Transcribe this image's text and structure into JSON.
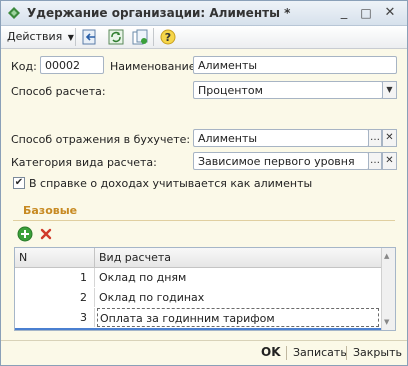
{
  "window": {
    "title": "Удержание организации: Алименты *",
    "controls": {
      "minimize": "_",
      "maximize": "□",
      "close": "✕"
    }
  },
  "toolbar": {
    "actions_label": "Действия",
    "icons": [
      "go-back-icon",
      "refresh-icon",
      "copy-icon",
      "help-icon"
    ]
  },
  "form": {
    "code_label": "Код:",
    "code_value": "00002",
    "name_label": "Наименование:",
    "name_value": "Алименты",
    "calc_method_label": "Способ расчета:",
    "calc_method_value": "Процентом",
    "accounting_label": "Способ отражения в бухучете:",
    "accounting_value": "Алименты",
    "category_label": "Категория вида расчета:",
    "category_value": "Зависимое первого уровня",
    "checkbox_label": "В справке о доходах учитывается как алименты",
    "checkbox_checked": true
  },
  "base_section": {
    "title": "Базовые",
    "table": {
      "columns": [
        "N",
        "Вид расчета"
      ],
      "rows": [
        {
          "n": "1",
          "calc_type": "Оклад по дням"
        },
        {
          "n": "2",
          "calc_type": "Оклад по годинах"
        },
        {
          "n": "3",
          "calc_type": "Оплата за годинним тарифом"
        }
      ]
    }
  },
  "footer": {
    "ok_label": "OK",
    "save_label": "Записать",
    "close_label": "Закрыть"
  },
  "colors": {
    "section_title": "#c78a22",
    "window_bg": "#fbf9e8",
    "add_icon": "#3aa03a",
    "delete_icon": "#d03a2a"
  }
}
